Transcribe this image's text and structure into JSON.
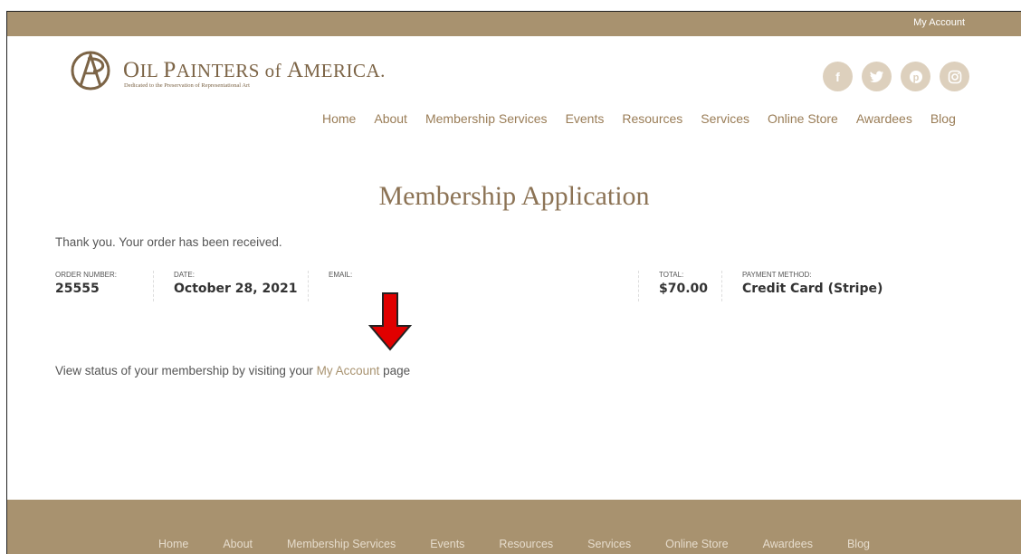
{
  "topbar": {
    "account_link": "My Account"
  },
  "logo": {
    "name_part1": "O",
    "name_part2": "IL ",
    "name_part3": "P",
    "name_part4": "AINTERS of ",
    "name_part5": "A",
    "name_part6": "MERICA.",
    "tagline": "Dedicated to the Preservation of Representational Art"
  },
  "social": [
    {
      "icon": "facebook-icon",
      "glyph": "f"
    },
    {
      "icon": "twitter-icon",
      "glyph": "🐦"
    },
    {
      "icon": "pinterest-icon",
      "glyph": "℗"
    },
    {
      "icon": "instagram-icon",
      "glyph": "◎"
    }
  ],
  "nav": {
    "items": [
      "Home",
      "About",
      "Membership Services",
      "Events",
      "Resources",
      "Services",
      "Online Store",
      "Awardees",
      "Blog"
    ]
  },
  "page": {
    "title": "Membership Application",
    "thanks": "Thank you. Your order has been received.",
    "order": {
      "number_label": "ORDER NUMBER:",
      "number": "25555",
      "date_label": "DATE:",
      "date": "October 28, 2021",
      "email_label": "EMAIL:",
      "email": "",
      "total_label": "TOTAL:",
      "total": "$70.00",
      "payment_label": "PAYMENT METHOD:",
      "payment": "Credit Card (Stripe)"
    },
    "view_prefix": "View status of your membership by visiting your ",
    "view_link": "My Account",
    "view_suffix": " page"
  },
  "footer": {
    "items": [
      "Home",
      "About",
      "Membership Services",
      "Events",
      "Resources",
      "Services",
      "Online Store",
      "Awardees",
      "Blog"
    ]
  },
  "colors": {
    "brand": "#a8926f",
    "arrow": "#e00000"
  }
}
